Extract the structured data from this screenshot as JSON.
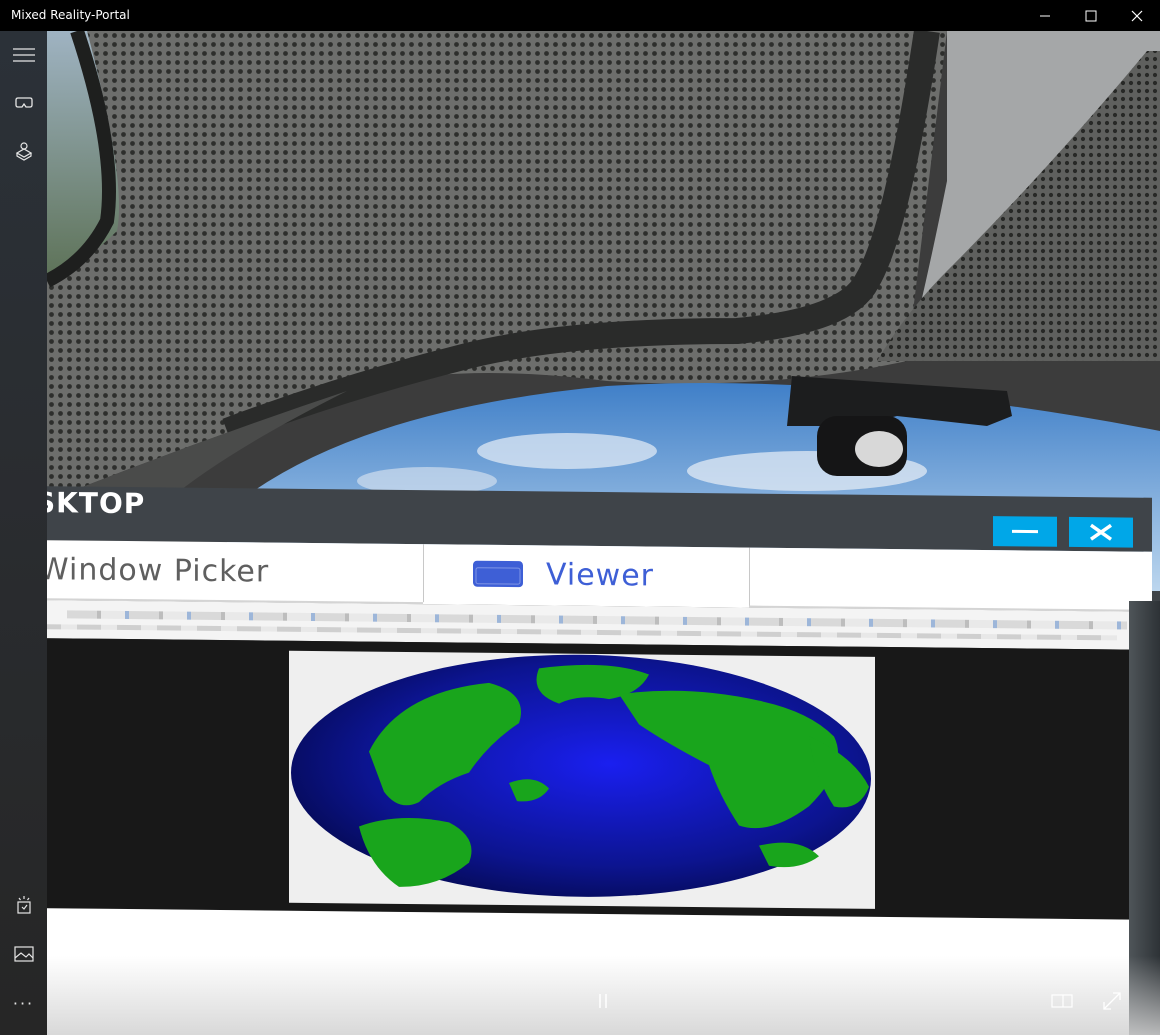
{
  "window": {
    "title": "Mixed Reality-Portal",
    "controls": [
      "minimize-icon",
      "maximize-icon",
      "close-icon"
    ]
  },
  "rail": {
    "top_items": [
      "hamburger-menu-icon",
      "headset-icon",
      "holograms-icon"
    ],
    "bottom_items": [
      "mirror-app-icon",
      "photo-icon",
      "more-icon"
    ],
    "more_label": "···"
  },
  "virtual_desktop": {
    "title": "SKTOP",
    "tabs": [
      {
        "label": "Window Picker",
        "active": false
      },
      {
        "label": "Viewer",
        "active": true
      }
    ],
    "button_color": "#00a7e8",
    "active_tab_color": "#3e5fd6"
  },
  "playback": {
    "pause_icon": "pause-icon",
    "pause_label": "||",
    "right_icons": [
      "snap-view-icon",
      "fullscreen-icon"
    ]
  }
}
